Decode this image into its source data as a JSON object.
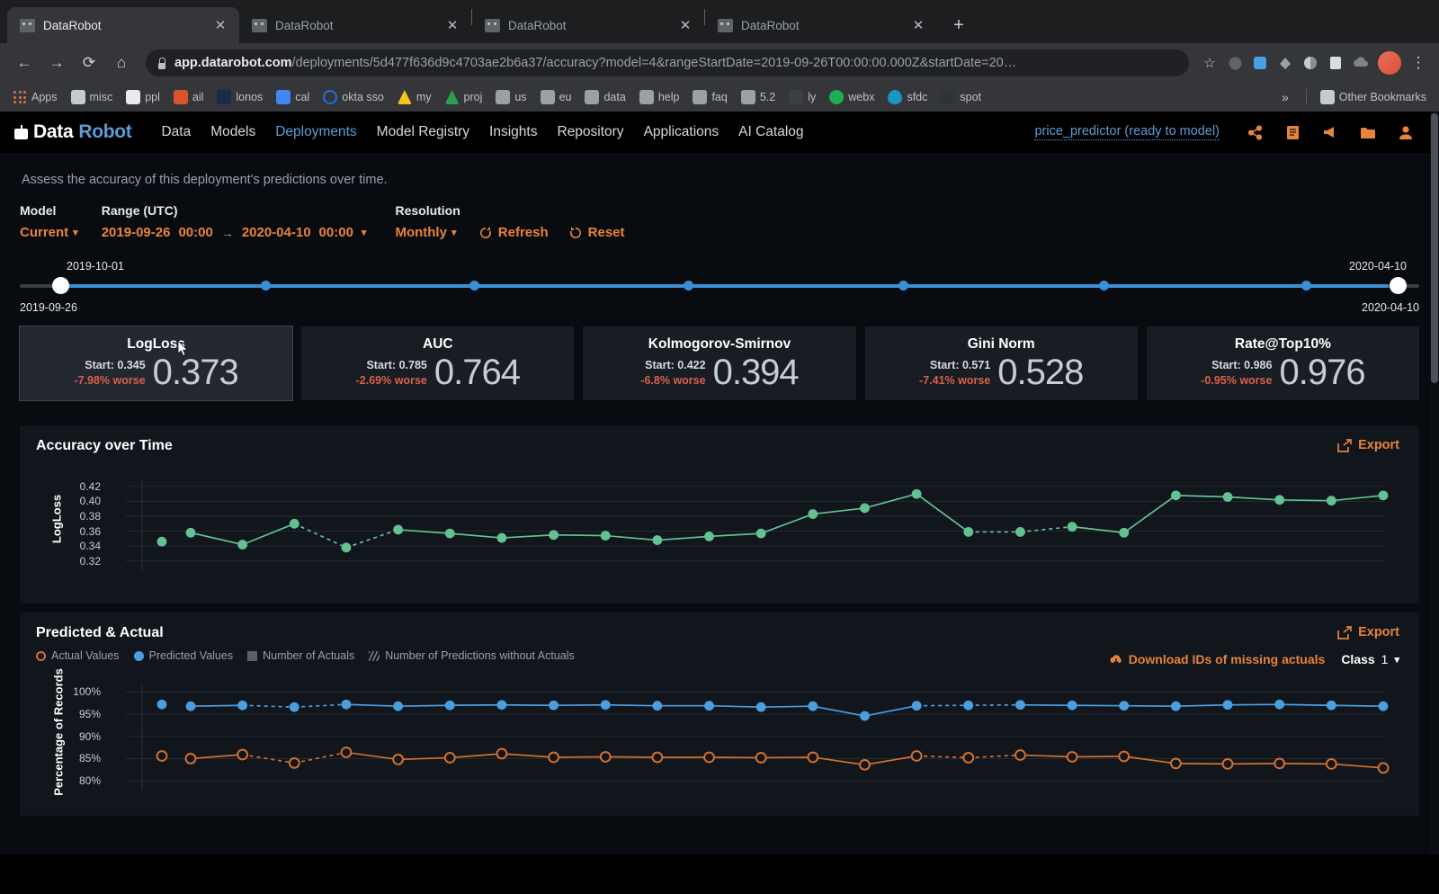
{
  "browser": {
    "tabs": [
      {
        "title": "DataRobot",
        "active": true
      },
      {
        "title": "DataRobot",
        "active": false
      },
      {
        "title": "DataRobot",
        "active": false
      },
      {
        "title": "DataRobot",
        "active": false
      }
    ],
    "close_label": "✕",
    "new_tab_label": "+",
    "nav": {
      "back": "←",
      "forward": "→",
      "reload": "⟳",
      "home": "⌂"
    },
    "url_domain": "app.datarobot.com",
    "url_path": "/deployments/5d477f636d9c4703ae2b6a37/accuracy?model=4&rangeStartDate=2019-09-26T00:00:00.000Z&startDate=20…",
    "star_icon": "☆",
    "kebab_icon": "⋮",
    "bookmarks": [
      {
        "label": "Apps",
        "icon": "grid"
      },
      {
        "label": "misc",
        "icon": "folder"
      },
      {
        "label": "ppl",
        "icon": "doc"
      },
      {
        "label": "ail",
        "icon": "mail"
      },
      {
        "label": "lonos",
        "icon": "bar"
      },
      {
        "label": "cal",
        "icon": "cal"
      },
      {
        "label": "okta sso",
        "icon": "okta"
      },
      {
        "label": "my",
        "icon": "drive"
      },
      {
        "label": "proj",
        "icon": "drive"
      },
      {
        "label": "us",
        "icon": "page"
      },
      {
        "label": "eu",
        "icon": "page"
      },
      {
        "label": "data",
        "icon": "page"
      },
      {
        "label": "help",
        "icon": "page"
      },
      {
        "label": "faq",
        "icon": "page"
      },
      {
        "label": "5.2",
        "icon": "page"
      },
      {
        "label": "ly",
        "icon": "page"
      },
      {
        "label": "webx",
        "icon": "webex"
      },
      {
        "label": "sfdc",
        "icon": "cloud"
      },
      {
        "label": "spot",
        "icon": "page"
      }
    ],
    "overflow_label": "»",
    "other_bookmarks": "Other Bookmarks"
  },
  "appnav": {
    "logo_data": "Data",
    "logo_robot": "Robot",
    "items": [
      {
        "label": "Data",
        "active": false
      },
      {
        "label": "Models",
        "active": false
      },
      {
        "label": "Deployments",
        "active": true
      },
      {
        "label": "Model Registry",
        "active": false
      },
      {
        "label": "Insights",
        "active": false
      },
      {
        "label": "Repository",
        "active": false
      },
      {
        "label": "Applications",
        "active": false
      },
      {
        "label": "AI Catalog",
        "active": false
      }
    ],
    "project": "price_predictor (ready to model)",
    "icons": [
      "share-icon",
      "notes-icon",
      "megaphone-icon",
      "folder-icon",
      "user-icon"
    ]
  },
  "page": {
    "subtitle": "Assess the accuracy of this deployment's predictions over time.",
    "filters": {
      "model_label": "Model",
      "model_value": "Current",
      "range_label": "Range (UTC)",
      "range_start_date": "2019-09-26",
      "range_start_time": "00:00",
      "range_arrow": "→",
      "range_end_date": "2020-04-10",
      "range_end_time": "00:00",
      "resolution_label": "Resolution",
      "resolution_value": "Monthly",
      "refresh_label": "Refresh",
      "reset_label": "Reset"
    },
    "slider": {
      "top_label": "2019-10-01",
      "top_right_label": "2020-04-10",
      "bottom_left_label": "2019-09-26",
      "bottom_right_label": "2020-04-10"
    },
    "metrics": [
      {
        "name": "LogLoss",
        "start": "Start: 0.345",
        "delta": "-7.98% worse",
        "value": "0.373",
        "selected": true
      },
      {
        "name": "AUC",
        "start": "Start: 0.785",
        "delta": "-2.69% worse",
        "value": "0.764",
        "selected": false
      },
      {
        "name": "Kolmogorov-Smirnov",
        "start": "Start: 0.422",
        "delta": "-6.8% worse",
        "value": "0.394",
        "selected": false
      },
      {
        "name": "Gini Norm",
        "start": "Start: 0.571",
        "delta": "-7.41% worse",
        "value": "0.528",
        "selected": false
      },
      {
        "name": "Rate@Top10%",
        "start": "Start: 0.986",
        "delta": "-0.95% worse",
        "value": "0.976",
        "selected": false
      }
    ],
    "accuracy_panel": {
      "title": "Accuracy over Time",
      "export_label": "Export"
    },
    "predicted_panel": {
      "title": "Predicted & Actual",
      "export_label": "Export",
      "legend": [
        {
          "label": "Actual Values",
          "marker": "ring",
          "color": "#d1702f"
        },
        {
          "label": "Predicted Values",
          "marker": "dot",
          "color": "#4a9fe0"
        },
        {
          "label": "Number of Actuals",
          "marker": "square",
          "color": "#5a5f68"
        },
        {
          "label": "Number of Predictions without Actuals",
          "marker": "hatch",
          "color": "#7d828b"
        }
      ],
      "download_label": "Download IDs of missing actuals",
      "class_label": "Class",
      "class_value": "1"
    }
  },
  "chart_data": [
    {
      "type": "line",
      "title": "Accuracy over Time",
      "ylabel": "LogLoss",
      "xlabel": "",
      "ylim": [
        0.31,
        0.432
      ],
      "yticks": [
        "0.42",
        "0.40",
        "0.38",
        "0.36",
        "0.34",
        "0.32"
      ],
      "ytick_values": [
        0.42,
        0.4,
        0.38,
        0.36,
        0.34,
        0.32
      ],
      "grid": true,
      "legend_position": "none",
      "color": "#63c291",
      "series": [
        {
          "name": "LogLoss",
          "values": [
            0.346,
            0.358,
            0.342,
            0.37,
            0.338,
            0.362,
            0.357,
            0.351,
            0.355,
            0.354,
            0.348,
            0.353,
            0.357,
            0.383,
            0.391,
            0.41,
            0.359,
            0.359,
            0.366,
            0.358,
            0.408,
            0.406,
            0.402,
            0.401,
            0.408
          ],
          "dashed_segments": [
            [
              3,
              4
            ],
            [
              4,
              5
            ],
            [
              16,
              17
            ],
            [
              17,
              18
            ]
          ],
          "detached_first_point": true
        }
      ]
    },
    {
      "type": "line",
      "title": "Predicted & Actual",
      "ylabel": "Percentage of Records",
      "xlabel": "",
      "ylim": [
        78,
        101.5
      ],
      "yticks": [
        "100%",
        "95%",
        "90%",
        "85%",
        "80%"
      ],
      "ytick_values": [
        100,
        95,
        90,
        85,
        80
      ],
      "grid": true,
      "legend_position": "top-left",
      "series": [
        {
          "name": "Predicted Values",
          "color": "#4a9fe0",
          "marker": "dot",
          "values": [
            97.2,
            96.8,
            97.0,
            96.6,
            97.2,
            96.8,
            97.0,
            97.1,
            97.0,
            97.1,
            96.9,
            96.9,
            96.6,
            96.8,
            94.6,
            96.9,
            97.0,
            97.1,
            97.0,
            96.9,
            96.8,
            97.1,
            97.2,
            97.0,
            96.8
          ],
          "dashed_segments": [
            [
              2,
              3
            ],
            [
              3,
              4
            ],
            [
              15,
              16
            ],
            [
              16,
              17
            ]
          ],
          "detached_first_point": true
        },
        {
          "name": "Actual Values",
          "color": "#d1702f",
          "marker": "ring",
          "values": [
            85.6,
            85.0,
            85.9,
            84.0,
            86.4,
            84.8,
            85.2,
            86.1,
            85.3,
            85.4,
            85.3,
            85.3,
            85.2,
            85.3,
            83.6,
            85.6,
            85.2,
            85.8,
            85.4,
            85.5,
            83.9,
            83.8,
            83.9,
            83.8,
            82.9
          ],
          "dashed_segments": [
            [
              2,
              3
            ],
            [
              3,
              4
            ],
            [
              15,
              16
            ],
            [
              16,
              17
            ]
          ],
          "detached_first_point": true
        }
      ]
    }
  ]
}
